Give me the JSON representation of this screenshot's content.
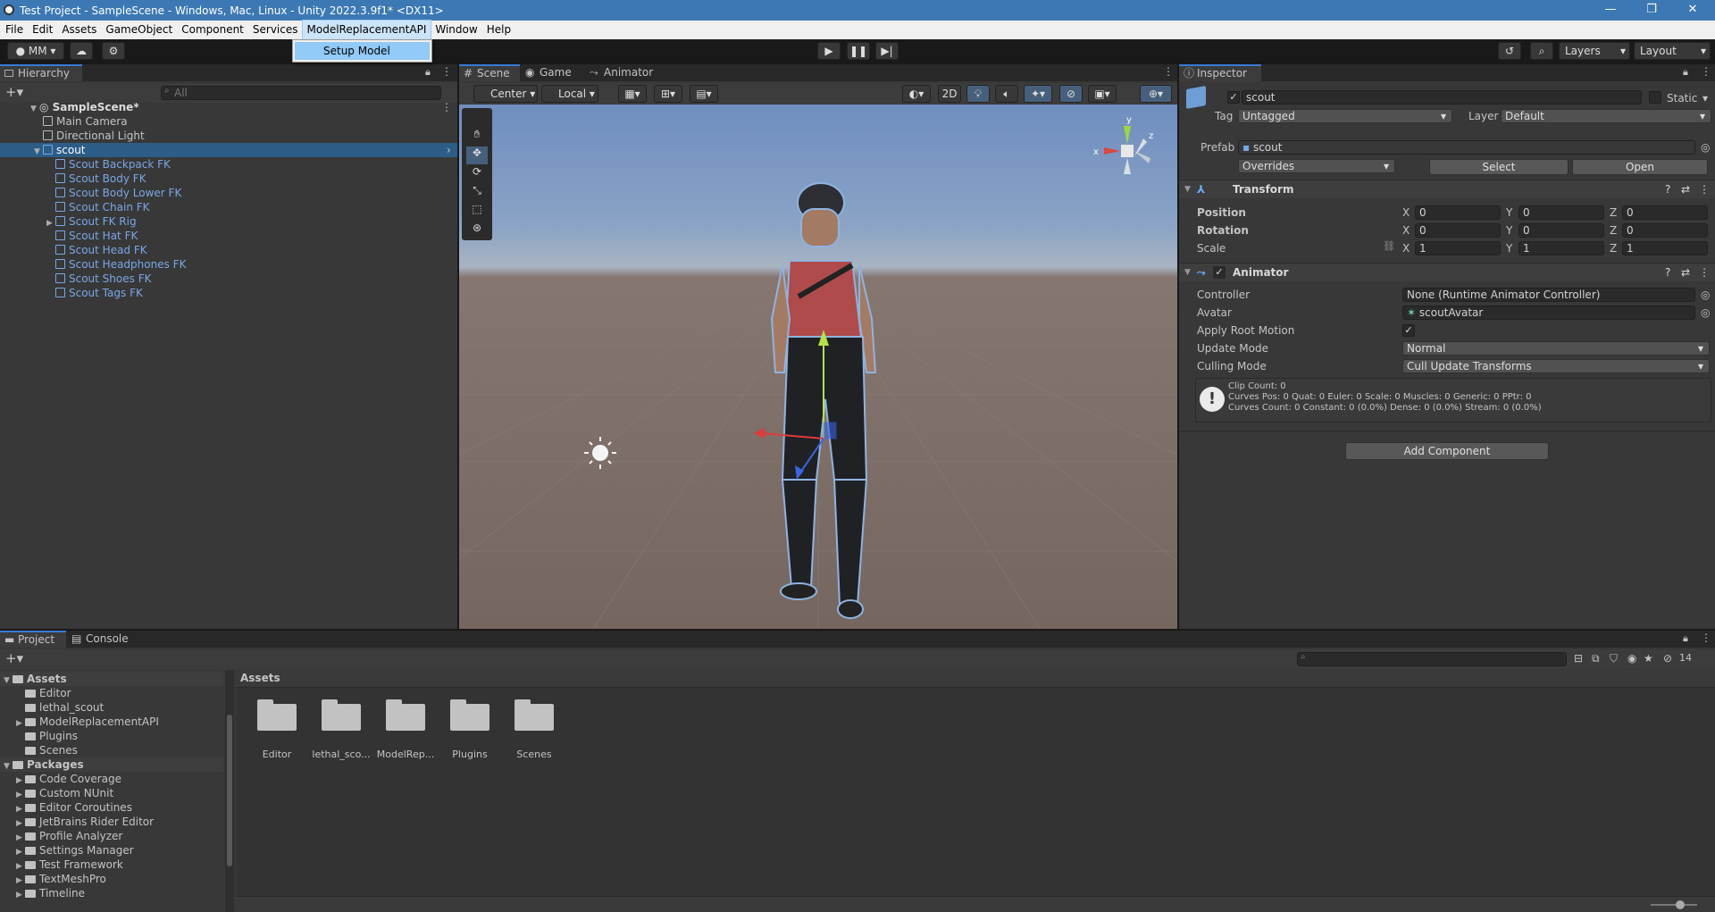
{
  "window": {
    "title": "Test Project - SampleScene - Windows, Mac, Linux - Unity 2022.3.9f1* <DX11>",
    "controls": [
      "—",
      "❐",
      "✕"
    ]
  },
  "menu": [
    "File",
    "Edit",
    "Assets",
    "GameObject",
    "Component",
    "Services",
    "ModelReplacementAPI",
    "Window",
    "Help"
  ],
  "dropdown_item": "Setup Model",
  "toolbar": {
    "account": "MM",
    "layers": "Layers",
    "layout": "Layout"
  },
  "hierarchy": {
    "tab": "Hierarchy",
    "search_placeholder": "All",
    "scene": "SampleScene*",
    "items": [
      {
        "label": "Main Camera",
        "indent": 0,
        "style": "normal",
        "expand": ""
      },
      {
        "label": "Directional Light",
        "indent": 0,
        "style": "normal",
        "expand": ""
      },
      {
        "label": "scout",
        "indent": 0,
        "style": "selected",
        "expand": "▼"
      },
      {
        "label": "Scout Backpack FK",
        "indent": 1,
        "style": "blue",
        "expand": ""
      },
      {
        "label": "Scout Body FK",
        "indent": 1,
        "style": "blue",
        "expand": ""
      },
      {
        "label": "Scout Body Lower FK",
        "indent": 1,
        "style": "blue",
        "expand": ""
      },
      {
        "label": "Scout Chain FK",
        "indent": 1,
        "style": "blue",
        "expand": ""
      },
      {
        "label": "Scout FK Rig",
        "indent": 1,
        "style": "blue",
        "expand": "▶"
      },
      {
        "label": "Scout Hat FK",
        "indent": 1,
        "style": "blue",
        "expand": ""
      },
      {
        "label": "Scout Head FK",
        "indent": 1,
        "style": "blue",
        "expand": ""
      },
      {
        "label": "Scout Headphones FK",
        "indent": 1,
        "style": "blue",
        "expand": ""
      },
      {
        "label": "Scout Shoes FK",
        "indent": 1,
        "style": "blue",
        "expand": ""
      },
      {
        "label": "Scout Tags FK",
        "indent": 1,
        "style": "blue",
        "expand": ""
      }
    ]
  },
  "scene_view": {
    "tabs": [
      "Scene",
      "Game",
      "Animator"
    ],
    "pivot": "Center",
    "space": "Local",
    "mode_2d": "2D",
    "gizmo_axes": {
      "x": "x",
      "y": "y",
      "z": "z"
    }
  },
  "inspector": {
    "tab": "Inspector",
    "name": "scout",
    "static_label": "Static",
    "tag_label": "Tag",
    "tag_value": "Untagged",
    "layer_label": "Layer",
    "layer_value": "Default",
    "prefab_label": "Prefab",
    "prefab_value": "scout",
    "overrides": "Overrides",
    "select": "Select",
    "open": "Open",
    "transform": {
      "title": "Transform",
      "rows": [
        {
          "label": "Position",
          "x": "0",
          "y": "0",
          "z": "0"
        },
        {
          "label": "Rotation",
          "x": "0",
          "y": "0",
          "z": "0"
        },
        {
          "label": "Scale",
          "x": "1",
          "y": "1",
          "z": "1"
        }
      ]
    },
    "animator": {
      "title": "Animator",
      "controller_label": "Controller",
      "controller_value": "None (Runtime Animator Controller)",
      "avatar_label": "Avatar",
      "avatar_value": "scoutAvatar",
      "root_motion_label": "Apply Root Motion",
      "update_mode_label": "Update Mode",
      "update_mode_value": "Normal",
      "culling_label": "Culling Mode",
      "culling_value": "Cull Update Transforms",
      "info_line1": "Clip Count: 0",
      "info_line2": "Curves Pos: 0 Quat: 0 Euler: 0 Scale: 0 Muscles: 0 Generic: 0 PPtr: 0",
      "info_line3": "Curves Count: 0 Constant: 0 (0.0%) Dense: 0 (0.0%) Stream: 0 (0.0%)"
    },
    "add_component": "Add Component"
  },
  "project": {
    "tabs": [
      "Project",
      "Console"
    ],
    "breadcrumb": "Assets",
    "hidden_count": "14",
    "tree": [
      {
        "label": "Assets",
        "indent": 0,
        "bold": true,
        "expand": "▼"
      },
      {
        "label": "Editor",
        "indent": 1,
        "bold": false,
        "expand": ""
      },
      {
        "label": "lethal_scout",
        "indent": 1,
        "bold": false,
        "expand": ""
      },
      {
        "label": "ModelReplacementAPI",
        "indent": 1,
        "bold": false,
        "expand": "▶"
      },
      {
        "label": "Plugins",
        "indent": 1,
        "bold": false,
        "expand": ""
      },
      {
        "label": "Scenes",
        "indent": 1,
        "bold": false,
        "expand": ""
      },
      {
        "label": "Packages",
        "indent": 0,
        "bold": true,
        "expand": "▼"
      },
      {
        "label": "Code Coverage",
        "indent": 1,
        "bold": false,
        "expand": "▶"
      },
      {
        "label": "Custom NUnit",
        "indent": 1,
        "bold": false,
        "expand": "▶"
      },
      {
        "label": "Editor Coroutines",
        "indent": 1,
        "bold": false,
        "expand": "▶"
      },
      {
        "label": "JetBrains Rider Editor",
        "indent": 1,
        "bold": false,
        "expand": "▶"
      },
      {
        "label": "Profile Analyzer",
        "indent": 1,
        "bold": false,
        "expand": "▶"
      },
      {
        "label": "Settings Manager",
        "indent": 1,
        "bold": false,
        "expand": "▶"
      },
      {
        "label": "Test Framework",
        "indent": 1,
        "bold": false,
        "expand": "▶"
      },
      {
        "label": "TextMeshPro",
        "indent": 1,
        "bold": false,
        "expand": "▶"
      },
      {
        "label": "Timeline",
        "indent": 1,
        "bold": false,
        "expand": "▶"
      }
    ],
    "folders": [
      "Editor",
      "lethal_sco...",
      "ModelRep...",
      "Plugins",
      "Scenes"
    ]
  },
  "colors": {
    "accent": "#3a7ad6",
    "selection": "#2c5d87",
    "titlebar": "#3c79b4"
  }
}
